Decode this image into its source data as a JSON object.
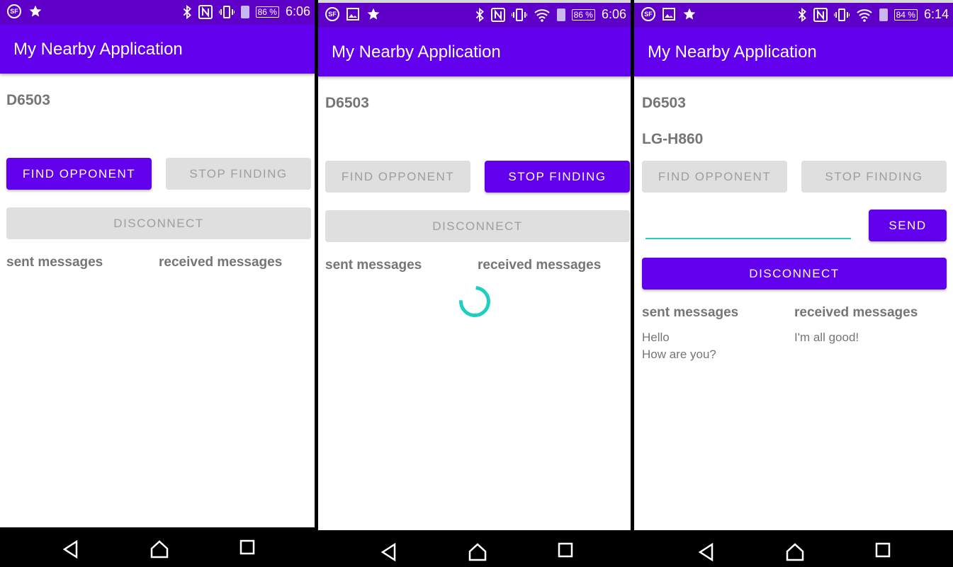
{
  "app_title": "My Nearby Application",
  "screens": [
    {
      "battery": "86 %",
      "time": "6:06",
      "device_name": "D6503",
      "find_label": "FIND OPPONENT",
      "stop_label": "STOP FINDING",
      "disconnect_label": "DISCONNECT",
      "sent_header": "sent messages",
      "received_header": "received messages"
    },
    {
      "battery": "86 %",
      "time": "6:06",
      "device_name": "D6503",
      "find_label": "FIND OPPONENT",
      "stop_label": "STOP FINDING",
      "disconnect_label": "DISCONNECT",
      "sent_header": "sent messages",
      "received_header": "received messages"
    },
    {
      "battery": "84 %",
      "time": "6:14",
      "device_name": "D6503",
      "opponent_name": "LG-H860",
      "find_label": "FIND OPPONENT",
      "stop_label": "STOP FINDING",
      "send_label": "SEND",
      "message_input_value": "",
      "disconnect_label": "DISCONNECT",
      "sent_header": "sent messages",
      "received_header": "received messages",
      "sent_messages": [
        "Hello",
        "How are you?"
      ],
      "received_messages": [
        "I'm all good!"
      ]
    }
  ],
  "colors": {
    "status_bar": "#5f00c8",
    "app_bar": "#6200ee",
    "accent": "#1ccfc2",
    "disabled_button": "#dfdfdf"
  },
  "icons": [
    "sf-notification-icon",
    "star-icon",
    "image-icon",
    "bluetooth-icon",
    "nfc-icon",
    "vibrate-icon",
    "wifi-icon",
    "battery-alert-icon",
    "back-icon",
    "home-icon",
    "recents-icon"
  ]
}
